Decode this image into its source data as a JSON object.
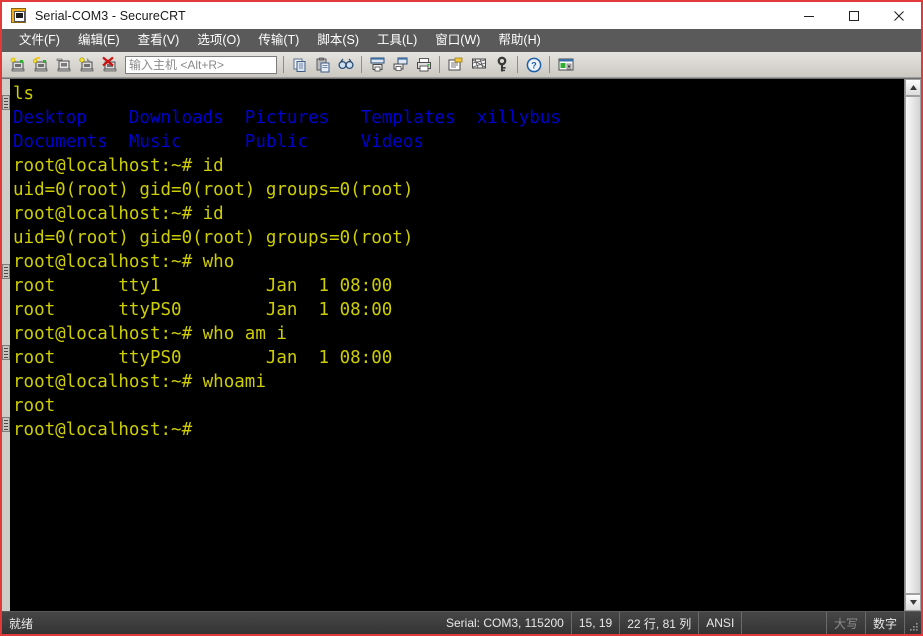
{
  "window": {
    "title": "Serial-COM3 - SecureCRT",
    "app_icon": "securecrt-icon",
    "minimize_label": "—",
    "maximize_label": "□",
    "close_label": "✕",
    "accent_border_color": "#e03a3a"
  },
  "menu": {
    "items": [
      {
        "label": "文件(F)",
        "name": "menu-file"
      },
      {
        "label": "编辑(E)",
        "name": "menu-edit"
      },
      {
        "label": "查看(V)",
        "name": "menu-view"
      },
      {
        "label": "选项(O)",
        "name": "menu-options"
      },
      {
        "label": "传输(T)",
        "name": "menu-transfer"
      },
      {
        "label": "脚本(S)",
        "name": "menu-script"
      },
      {
        "label": "工具(L)",
        "name": "menu-tools"
      },
      {
        "label": "窗口(W)",
        "name": "menu-window"
      },
      {
        "label": "帮助(H)",
        "name": "menu-help"
      }
    ]
  },
  "toolbar": {
    "host_input_placeholder": "输入主机 <Alt+R>",
    "host_input_value": "",
    "buttons": [
      {
        "name": "new-session-icon",
        "tip": "new-session"
      },
      {
        "name": "connect-icon",
        "tip": "connect"
      },
      {
        "name": "connect-local-shell-icon",
        "tip": "connect-local-shell"
      },
      {
        "name": "connect-sftp-icon",
        "tip": "connect-sftp"
      },
      {
        "name": "disconnect-icon",
        "tip": "disconnect"
      },
      {
        "name": "copy-icon",
        "tip": "copy"
      },
      {
        "name": "paste-icon",
        "tip": "paste"
      },
      {
        "name": "find-icon",
        "tip": "find"
      },
      {
        "name": "print-screen-icon",
        "tip": "print-screen"
      },
      {
        "name": "print-selection-icon",
        "tip": "print-selection"
      },
      {
        "name": "print-icon",
        "tip": "print"
      },
      {
        "name": "log-session-icon",
        "tip": "log-session"
      },
      {
        "name": "clear-screen-icon",
        "tip": "clear-screen"
      },
      {
        "name": "key-icon",
        "tip": "public-key"
      },
      {
        "name": "help-icon",
        "tip": "help"
      },
      {
        "name": "session-options-icon",
        "tip": "session-options"
      }
    ]
  },
  "terminal": {
    "background_color": "#000000",
    "foreground_color": "#cdcd00",
    "directory_color": "#0000cc",
    "lines": [
      {
        "text": "ls",
        "color": "fg"
      },
      {
        "text": "Desktop    Downloads  Pictures   Templates  xillybus",
        "color": "dir"
      },
      {
        "text": "Documents  Music      Public     Videos",
        "color": "dir"
      },
      {
        "text": "root@localhost:~# id",
        "color": "fg"
      },
      {
        "text": "uid=0(root) gid=0(root) groups=0(root)",
        "color": "fg"
      },
      {
        "text": "root@localhost:~# id",
        "color": "fg"
      },
      {
        "text": "uid=0(root) gid=0(root) groups=0(root)",
        "color": "fg"
      },
      {
        "text": "root@localhost:~# who",
        "color": "fg"
      },
      {
        "text": "root      tty1          Jan  1 08:00",
        "color": "fg"
      },
      {
        "text": "root      ttyPS0        Jan  1 08:00",
        "color": "fg"
      },
      {
        "text": "root@localhost:~# who am i",
        "color": "fg"
      },
      {
        "text": "root      ttyPS0        Jan  1 08:00",
        "color": "fg"
      },
      {
        "text": "root@localhost:~# whoami",
        "color": "fg"
      },
      {
        "text": "root",
        "color": "fg"
      },
      {
        "text": "root@localhost:~#",
        "color": "fg"
      }
    ]
  },
  "scrollbar": {
    "up_arrow": "▲",
    "down_arrow": "▼"
  },
  "status_bar": {
    "ready": "就绪",
    "connection": "Serial: COM3, 115200",
    "cursor_position": "15, 19",
    "screen_size": "22 行, 81 列",
    "emulation": "ANSI",
    "caps_lock": "大写",
    "num_lock": "数字"
  }
}
